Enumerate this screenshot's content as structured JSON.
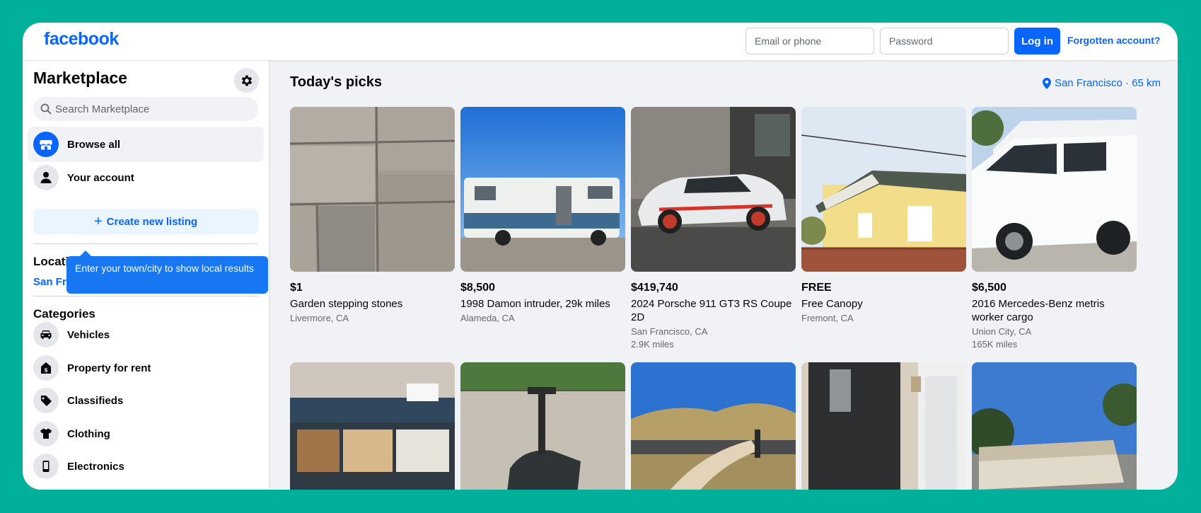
{
  "header": {
    "logo": "facebook",
    "email_placeholder": "Email or phone",
    "password_placeholder": "Password",
    "login_label": "Log in",
    "forgot_label": "Forgotten account?"
  },
  "sidebar": {
    "title": "Marketplace",
    "search_placeholder": "Search Marketplace",
    "nav": [
      {
        "label": "Browse all",
        "icon": "storefront-icon"
      },
      {
        "label": "Your account",
        "icon": "user-icon"
      }
    ],
    "create_listing_label": "Create new listing",
    "location_title": "Location",
    "location_value": "San Francisco, California",
    "tooltip": "Enter your town/city to show local results",
    "categories_title": "Categories",
    "categories": [
      {
        "label": "Vehicles",
        "icon": "car-icon"
      },
      {
        "label": "Property for rent",
        "icon": "house-icon"
      },
      {
        "label": "Classifieds",
        "icon": "tag-icon"
      },
      {
        "label": "Clothing",
        "icon": "shirt-icon"
      },
      {
        "label": "Electronics",
        "icon": "phone-icon"
      }
    ]
  },
  "main": {
    "title": "Today's picks",
    "location_badge": "San Francisco · 65 km",
    "listings": [
      {
        "price": "$1",
        "title": "Garden stepping stones",
        "location": "Livermore, CA",
        "miles": ""
      },
      {
        "price": "$8,500",
        "title": "1998 Damon intruder, 29k miles",
        "location": "Alameda, CA",
        "miles": ""
      },
      {
        "price": "$419,740",
        "title": "2024 Porsche 911 GT3 RS Coupe 2D",
        "location": "San Francisco, CA",
        "miles": "2.9K miles"
      },
      {
        "price": "FREE",
        "title": "Free Canopy",
        "location": "Fremont, CA",
        "miles": ""
      },
      {
        "price": "$6,500",
        "title": "2016 Mercedes-Benz metris worker cargo",
        "location": "Union City, CA",
        "miles": "165K miles"
      }
    ]
  },
  "colors": {
    "brand": "#0866ff",
    "background": "#00b09b",
    "tooltip": "#1877f2"
  }
}
